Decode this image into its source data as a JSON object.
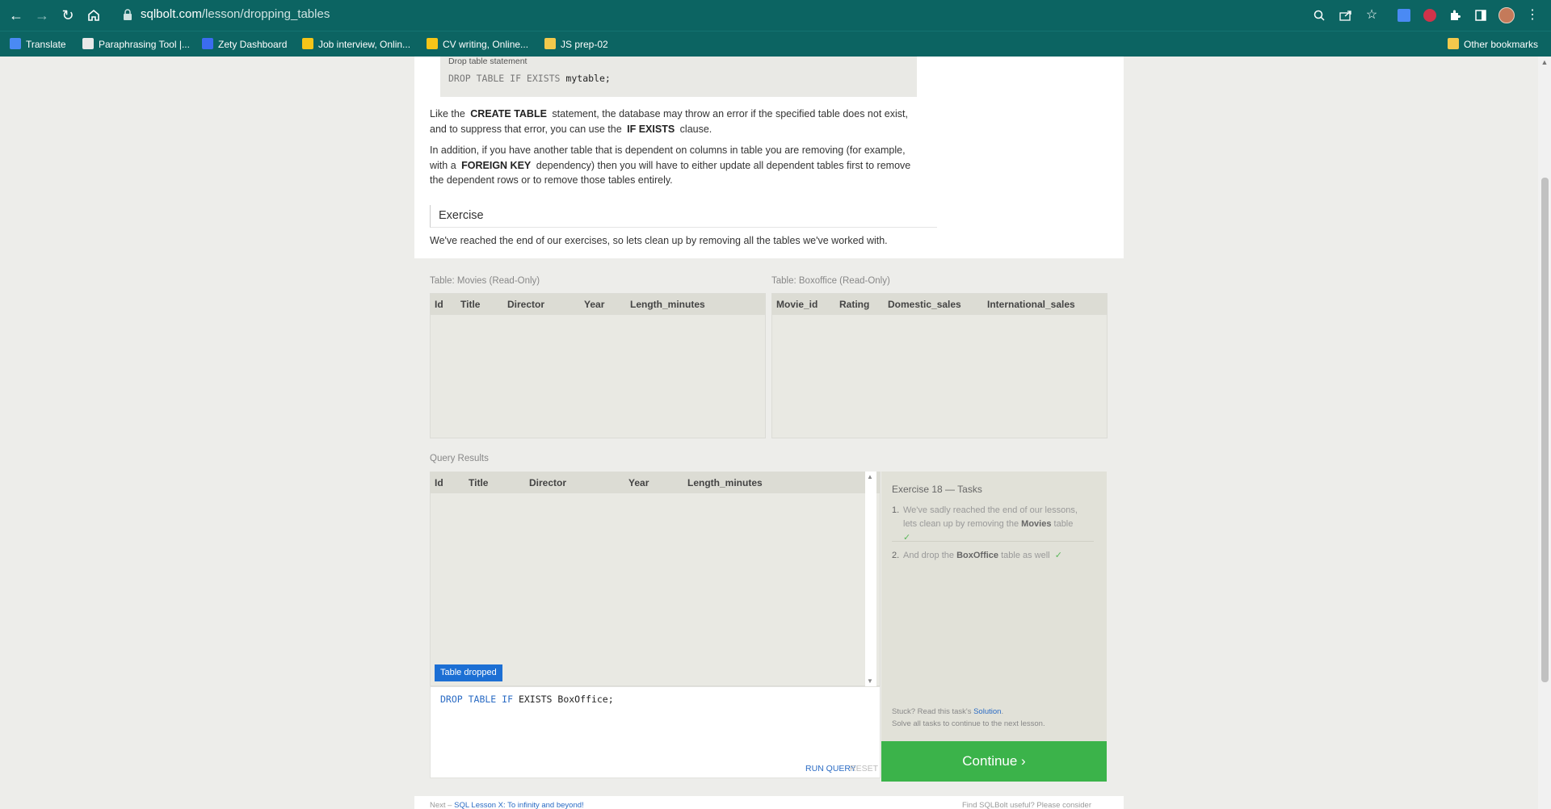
{
  "browser": {
    "url_domain": "sqlbolt.com",
    "url_path": "/lesson/dropping_tables",
    "bookmarks": [
      {
        "label": "Translate",
        "color": "#4a8af4"
      },
      {
        "label": "Paraphrasing Tool |...",
        "color": "#e8e8e8"
      },
      {
        "label": "Zety Dashboard",
        "color": "#3b6cf0"
      },
      {
        "label": "Job interview, Onlin...",
        "color": "#f5c518"
      },
      {
        "label": "CV writing, Online...",
        "color": "#f5c518"
      },
      {
        "label": "JS prep-02",
        "color": "#f2c94c"
      }
    ],
    "other_bookmarks": "Other bookmarks"
  },
  "lesson": {
    "code_caption": "Drop table statement",
    "code_kw": "DROP TABLE IF EXISTS",
    "code_ident": "mytable;",
    "para1": {
      "a": "Like the",
      "b": "CREATE TABLE",
      "c": "statement, the database may throw an error if the specified table does not exist,",
      "d": "and to suppress that error, you can use the",
      "e": "IF EXISTS",
      "f": "clause."
    },
    "para2": {
      "a": "In addition, if you have another table that is dependent on columns in table you are removing (for example,",
      "b": "with a",
      "c": "FOREIGN KEY",
      "d": "dependency) then you will have to either update all dependent tables first to remove",
      "e": "the dependent rows or to remove those tables entirely."
    },
    "exercise_title": "Exercise",
    "exercise_text": "We've reached the end of our exercises, so lets clean up by removing all the tables we've worked with."
  },
  "tables": {
    "movies": {
      "label": "Table: Movies (Read-Only)",
      "columns": [
        "Id",
        "Title",
        "Director",
        "Year",
        "Length_minutes"
      ]
    },
    "boxoffice": {
      "label": "Table: Boxoffice (Read-Only)",
      "columns": [
        "Movie_id",
        "Rating",
        "Domestic_sales",
        "International_sales"
      ]
    }
  },
  "results": {
    "label": "Query Results",
    "columns": [
      "Id",
      "Title",
      "Director",
      "Year",
      "Length_minutes"
    ],
    "status": "Table dropped"
  },
  "editor": {
    "kw": "DROP TABLE IF",
    "rest": " EXISTS BoxOffice;",
    "run": "RUN QUERY",
    "reset": "RESET"
  },
  "tasks": {
    "title": "Exercise 18 — Tasks",
    "items": [
      {
        "num": "1.",
        "pre": "We've sadly reached the end of our lessons, lets clean up by removing the",
        "bold": "Movies",
        "post": "table",
        "check": "✓"
      },
      {
        "num": "2.",
        "pre": "And drop the",
        "bold": "BoxOffice",
        "post": "table as well",
        "check": "✓"
      }
    ],
    "stuck_a": "Stuck? Read this task's",
    "stuck_link": "Solution",
    "stuck_b": ".",
    "solve_all": "Solve all tasks to continue to the next lesson.",
    "continue": "Continue ›"
  },
  "footer": {
    "left_a": "Next –",
    "left_link": "SQL Lesson X: To infinity and beyond!",
    "right": "Find SQLBolt useful? Please consider"
  }
}
